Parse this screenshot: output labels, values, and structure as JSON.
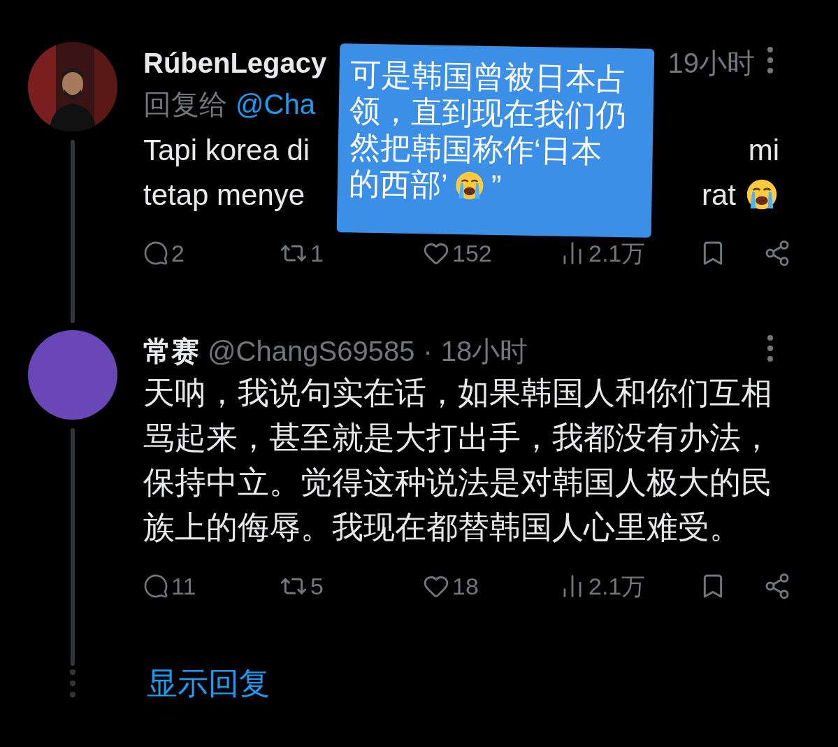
{
  "tweets": [
    {
      "name": "RúbenLegacy",
      "time": "19小时",
      "reply_to": {
        "prefix": "回复给",
        "handle": "@Cha"
      },
      "body_lines": [
        {
          "left": "Tapi korea di",
          "right": "mi"
        },
        {
          "left": "tetap menye",
          "right": "rat",
          "emoji": true
        }
      ],
      "actions": {
        "replies": "2",
        "reposts": "1",
        "likes": "152",
        "views": "2.1万"
      }
    },
    {
      "avatar": {
        "kind": "color",
        "color": "#6a47b6"
      },
      "name": "常赛",
      "handle": "@ChangS69585",
      "separator": "·",
      "time": "18小时",
      "body": "天呐，我说句实在话，如果韩国人和你们互相骂起来，甚至就是大打出手，我都没有办法，保持中立。觉得这种说法是对韩国人极大的民族上的侮辱。我现在都替韩国人心里难受。",
      "actions": {
        "replies": "11",
        "reposts": "5",
        "likes": "18",
        "views": "2.1万"
      }
    }
  ],
  "show_replies": "显示回复",
  "sticker": {
    "lines": [
      "可是韩国曾被日本占",
      "领，直到现在我们仍",
      "然把韩国称作‘日本",
      "的西部’"
    ],
    "emoji_after_last": true,
    "tail": "”"
  }
}
